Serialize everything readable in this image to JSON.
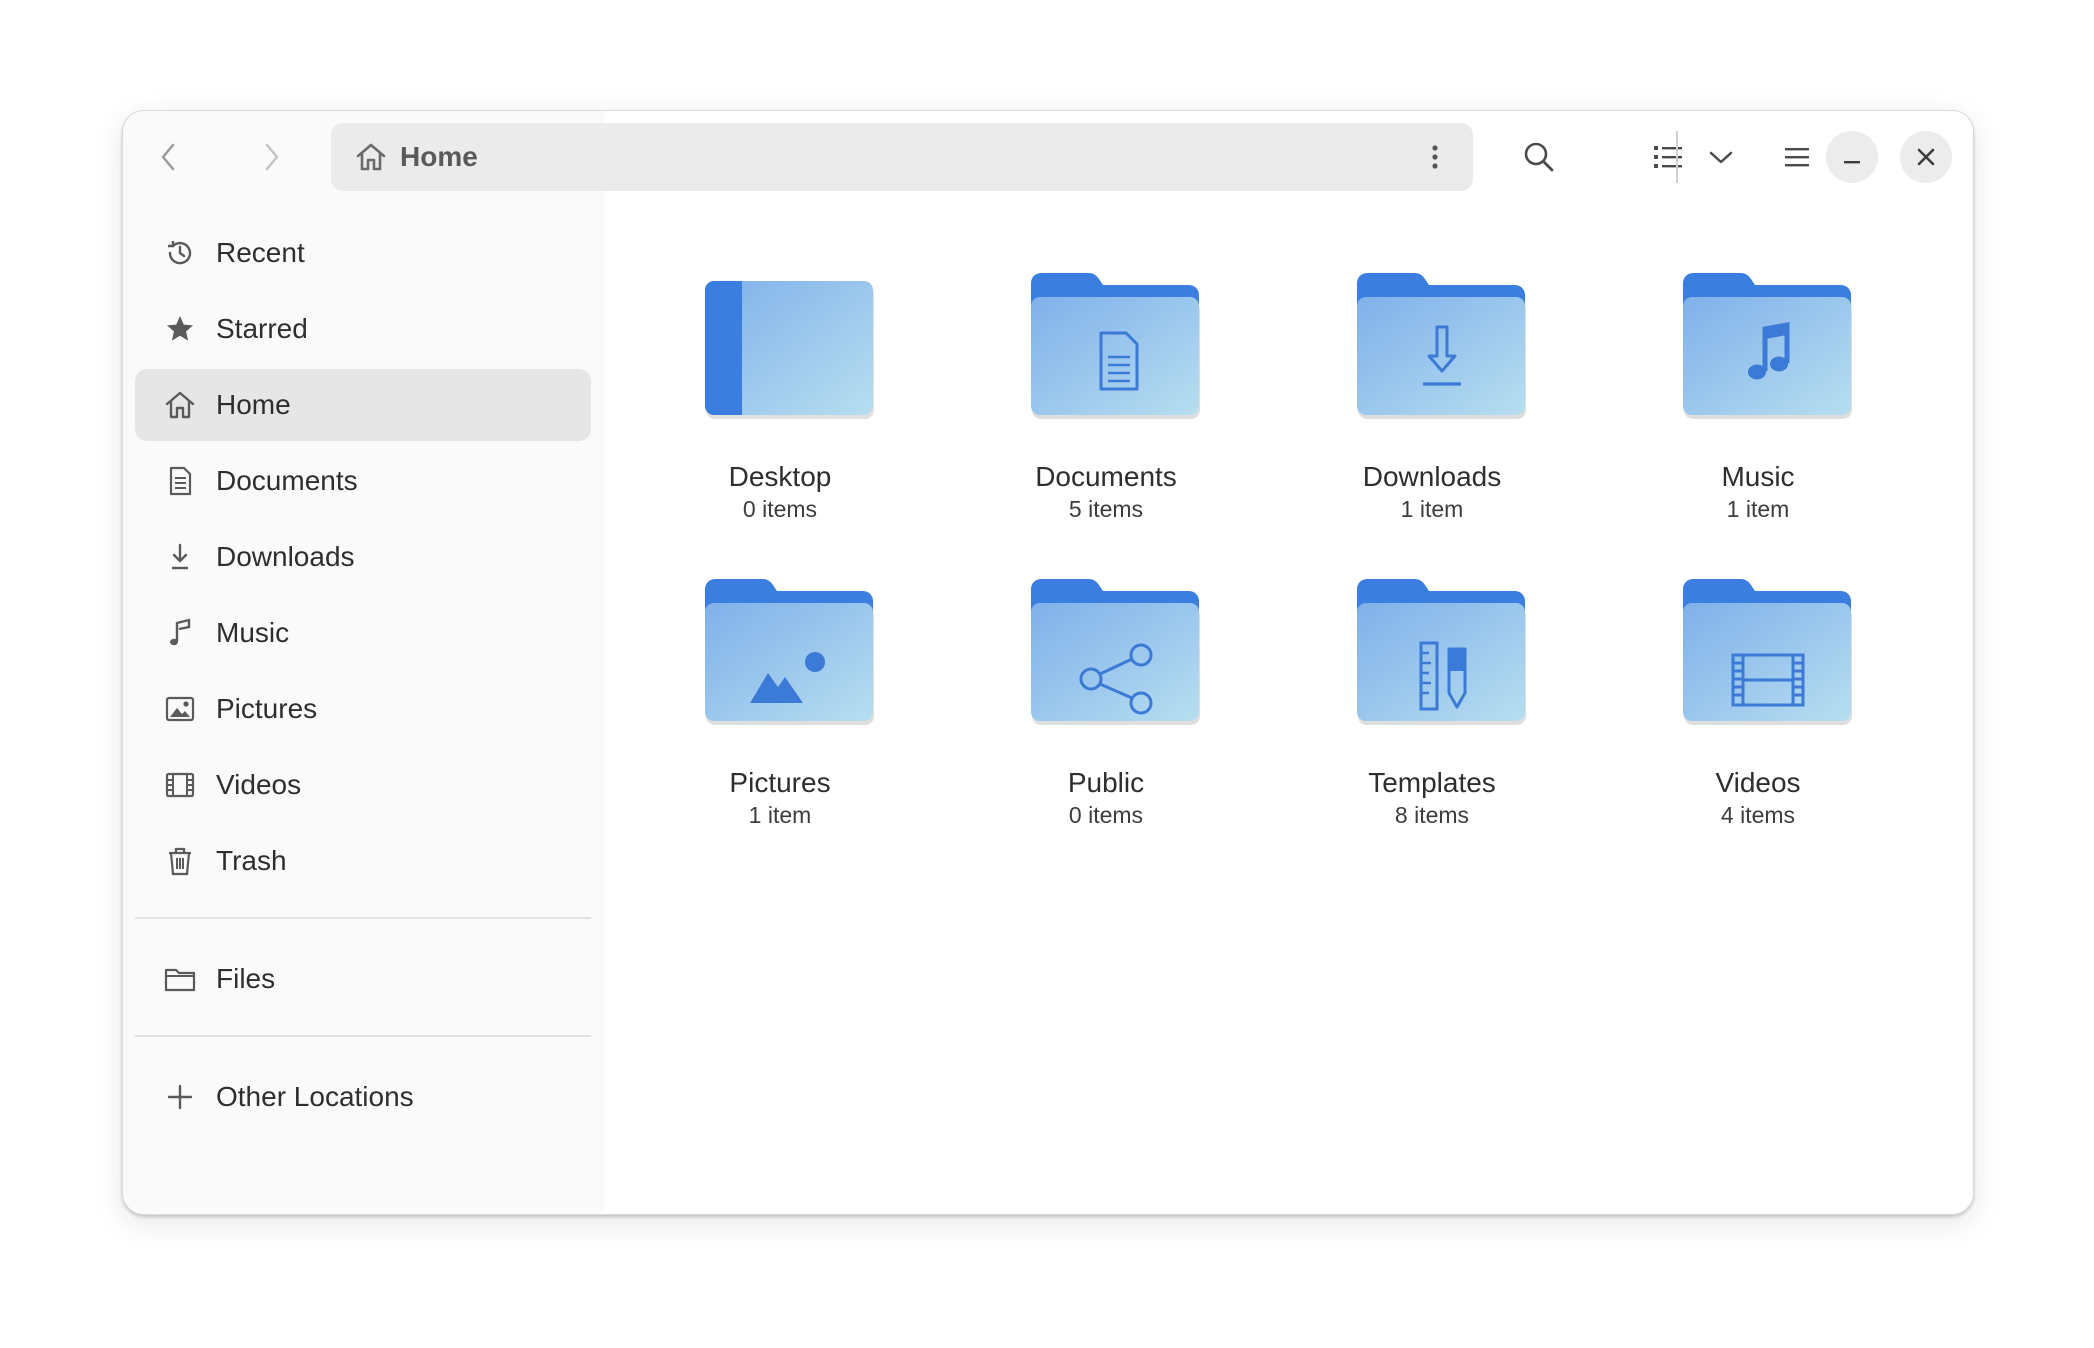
{
  "pathbar": {
    "location": "Home"
  },
  "sidebar": {
    "places": [
      {
        "label": "Recent",
        "icon": "clock-icon",
        "active": false
      },
      {
        "label": "Starred",
        "icon": "star-icon",
        "active": false
      },
      {
        "label": "Home",
        "icon": "home-icon",
        "active": true
      },
      {
        "label": "Documents",
        "icon": "document-icon",
        "active": false
      },
      {
        "label": "Downloads",
        "icon": "download-icon",
        "active": false
      },
      {
        "label": "Music",
        "icon": "music-note-icon",
        "active": false
      },
      {
        "label": "Pictures",
        "icon": "picture-icon",
        "active": false
      },
      {
        "label": "Videos",
        "icon": "film-icon",
        "active": false
      },
      {
        "label": "Trash",
        "icon": "trash-icon",
        "active": false
      }
    ],
    "files": {
      "label": "Files",
      "icon": "folder-outline-icon"
    },
    "other": {
      "label": "Other Locations",
      "icon": "plus-icon"
    }
  },
  "folders": [
    {
      "name": "Desktop",
      "count": "0 items",
      "emblem": "desktop"
    },
    {
      "name": "Documents",
      "count": "5 items",
      "emblem": "document"
    },
    {
      "name": "Downloads",
      "count": "1 item",
      "emblem": "download"
    },
    {
      "name": "Music",
      "count": "1 item",
      "emblem": "music"
    },
    {
      "name": "Pictures",
      "count": "1 item",
      "emblem": "pictures"
    },
    {
      "name": "Public",
      "count": "0 items",
      "emblem": "share"
    },
    {
      "name": "Templates",
      "count": "8 items",
      "emblem": "templates"
    },
    {
      "name": "Videos",
      "count": "4 items",
      "emblem": "videos"
    }
  ],
  "colors": {
    "folder_back": "#3a7fe0",
    "folder_front_start": "#7fb0ea",
    "folder_front_end": "#b7def0",
    "emblem": "#3b7ad6",
    "sidebar_active": "#e6e6e6"
  }
}
